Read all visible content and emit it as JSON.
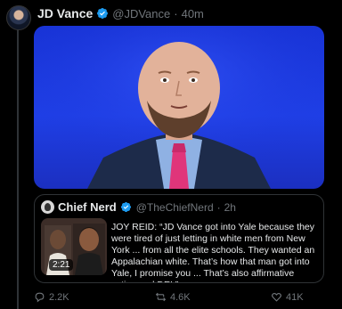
{
  "tweet": {
    "author_name": "JD Vance",
    "author_handle": "@JDVance",
    "separator": "·",
    "time": "40m"
  },
  "quoted": {
    "author_name": "Chief Nerd",
    "author_handle": "@TheChiefNerd",
    "separator": "·",
    "time": "2h",
    "video_duration": "2:21",
    "text": "JOY REID: “JD Vance got into Yale because they were tired of just letting in white men from New York ... from all the elite schools. They wanted an Appalachian white. That’s how that man got into Yale, I promise you ... That’s also affirmative action and DEI.”"
  },
  "actions": {
    "replies": "2.2K",
    "retweets": "4.6K",
    "likes": "41K"
  },
  "colors": {
    "verified": "#1d9bf0",
    "muted": "#71767b",
    "video_background": "#1f3fe6",
    "tie": "#e0357a"
  },
  "icons": [
    "verified-badge-icon",
    "reply-icon",
    "retweet-icon",
    "like-icon"
  ]
}
